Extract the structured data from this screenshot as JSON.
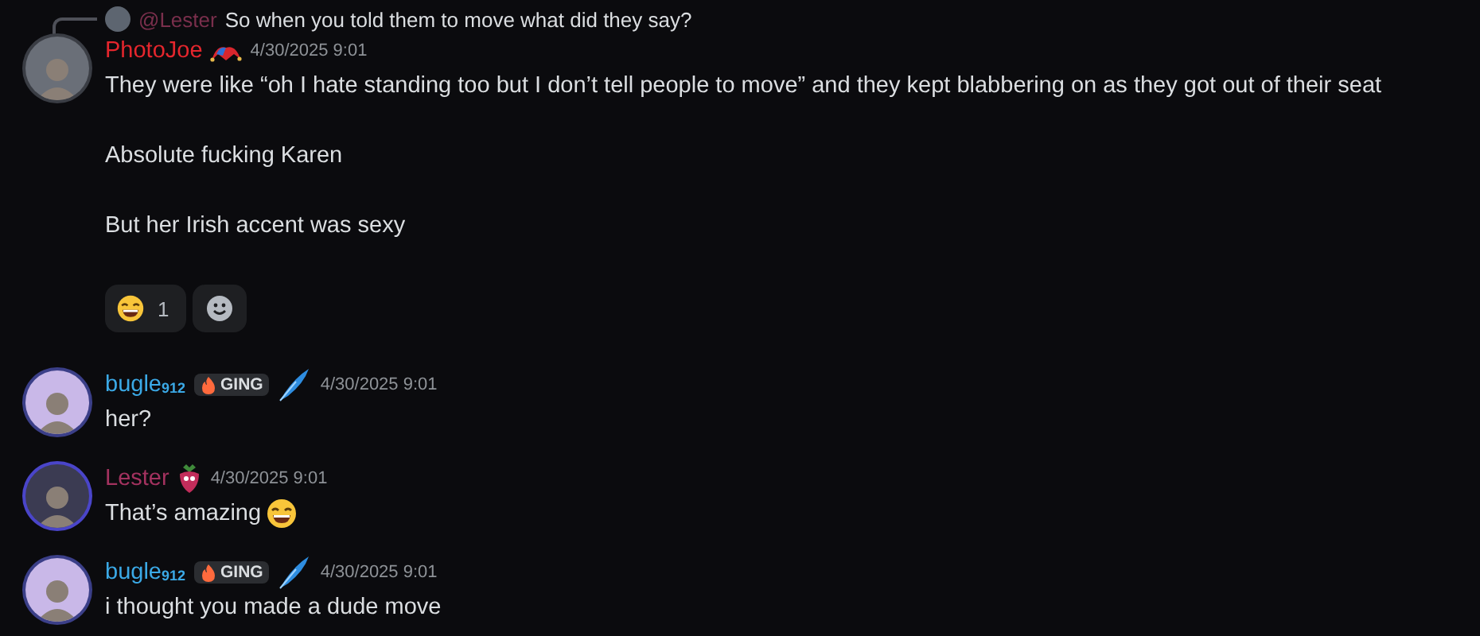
{
  "messages": [
    {
      "author": "PhotoJoe",
      "color": "#e5262d",
      "kind": "jester",
      "timestamp": "4/30/2025 9:01",
      "reply": {
        "author": "@Lester",
        "color": "#7a2f4c",
        "text": "So when you told them to move what did they say?"
      },
      "paragraphs": [
        "They were like “oh I hate standing too but I don’t tell people to move” and they kept blabbering on as they got out of their seat",
        "Absolute fucking Karen",
        "But her Irish accent was sexy"
      ],
      "reactions": [
        {
          "count": "1",
          "selected": false
        }
      ]
    },
    {
      "author": "bugle$_{912}$",
      "color": "#3ba9e6",
      "tag": "GING",
      "kind": "feather",
      "timestamp": "4/30/2025 9:01",
      "paragraphs": [
        "her?"
      ]
    },
    {
      "author": "Lester",
      "color": "#a3325f",
      "kind": "berry",
      "timestamp": "4/30/2025 9:01",
      "paragraphs": [
        "That’s amazing"
      ],
      "trailing_emoji": true
    },
    {
      "author": "bugle$_{912}$",
      "color": "#3ba9e6",
      "tag": "GING",
      "kind": "feather",
      "timestamp": "4/30/2025 9:01",
      "paragraphs": [
        "i thought you made a dude move"
      ]
    }
  ]
}
